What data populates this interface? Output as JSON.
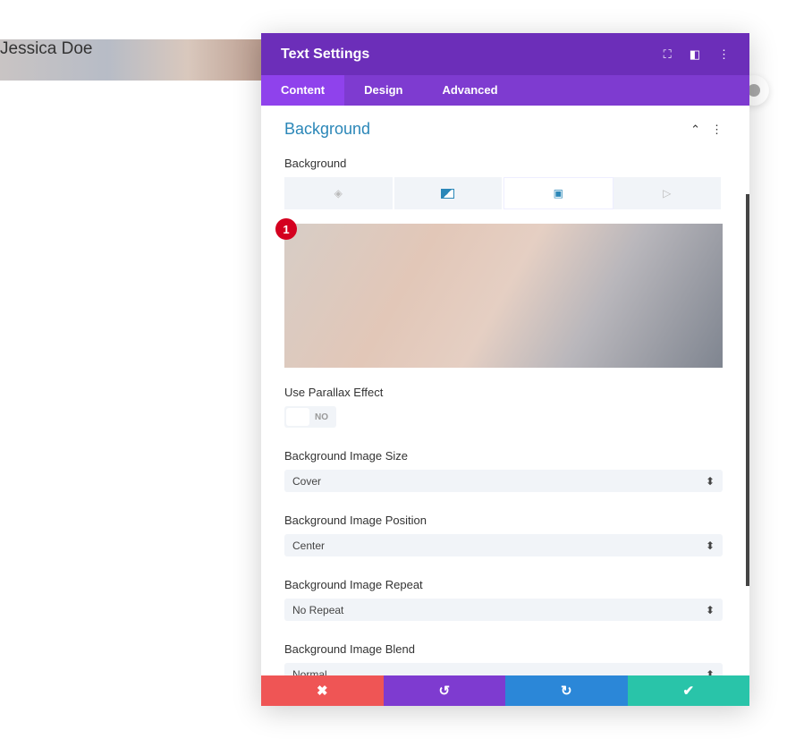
{
  "page": {
    "name": "Jessica Doe"
  },
  "modal": {
    "title": "Text Settings",
    "tabs": [
      {
        "label": "Content"
      },
      {
        "label": "Design"
      },
      {
        "label": "Advanced"
      }
    ],
    "section": "Background",
    "field_label": "Background",
    "badge": "1",
    "parallax": {
      "label": "Use Parallax Effect",
      "value": "NO"
    },
    "selects": [
      {
        "label": "Background Image Size",
        "value": "Cover"
      },
      {
        "label": "Background Image Position",
        "value": "Center"
      },
      {
        "label": "Background Image Repeat",
        "value": "No Repeat"
      },
      {
        "label": "Background Image Blend",
        "value": "Normal"
      }
    ],
    "footer": {
      "cancel": "✖",
      "undo": "↺",
      "redo": "↻",
      "save": "✔"
    }
  },
  "colors": {
    "header": "#6c2eb9",
    "tabs": "#7e3bd0",
    "accent": "#2b87b8",
    "cancel": "#ef5555",
    "undo": "#7e3bd0",
    "redo": "#2b87d8",
    "save": "#29c4a9"
  }
}
